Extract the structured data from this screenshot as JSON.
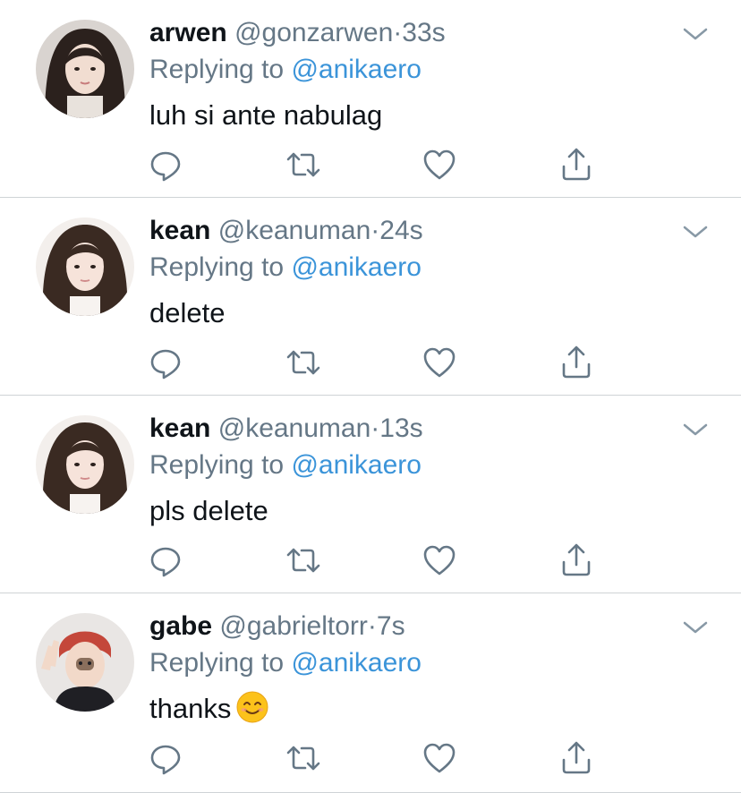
{
  "tweets": [
    {
      "name": "arwen",
      "handle": "@gonzarwen",
      "separator": "·",
      "time": "33s",
      "replying_label": "Replying to",
      "replying_to": "@anikaero",
      "text": "luh si ante nabulag",
      "avatar": "avatar-dark-hair-woman"
    },
    {
      "name": "kean",
      "handle": "@keanuman",
      "separator": "·",
      "time": "24s",
      "replying_label": "Replying to",
      "replying_to": "@anikaero",
      "text": "delete",
      "avatar": "avatar-long-hair-woman"
    },
    {
      "name": "kean",
      "handle": "@keanuman",
      "separator": "·",
      "time": "13s",
      "replying_label": "Replying to",
      "replying_to": "@anikaero",
      "text": "pls delete",
      "avatar": "avatar-long-hair-woman"
    },
    {
      "name": "gabe",
      "handle": "@gabrieltorr",
      "separator": "·",
      "time": "7s",
      "replying_label": "Replying to",
      "replying_to": "@anikaero",
      "text": "thanks",
      "emoji": "smiling-face-emoji",
      "avatar": "avatar-red-hair-man"
    }
  ],
  "icons": {
    "reply": "reply-icon",
    "retweet": "retweet-icon",
    "like": "heart-icon",
    "share": "share-icon",
    "more": "chevron-down-icon"
  },
  "colors": {
    "text": "#0f1419",
    "secondary": "#657786",
    "link": "#3b94d9",
    "divider": "#cfd3d6",
    "icon": "#657786"
  }
}
